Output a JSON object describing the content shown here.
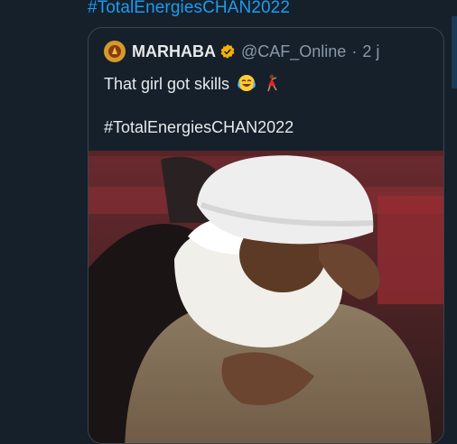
{
  "header": {
    "hashtag": "#TotalEnergiesCHAN2022"
  },
  "quoted_tweet": {
    "author_name": "MARHABA",
    "handle": "@CAF_Online",
    "separator": "·",
    "time": "2 j",
    "text_line1": "That girl got skills",
    "emojis": [
      "face-with-tears-of-joy",
      "dancer"
    ],
    "text_line2": "#TotalEnergiesCHAN2022"
  },
  "colors": {
    "background": "#15202b",
    "link": "#1d9bf0",
    "primary_text": "#e7e9ea",
    "secondary_text": "#8b98a5",
    "verified": "#f3b20a"
  }
}
